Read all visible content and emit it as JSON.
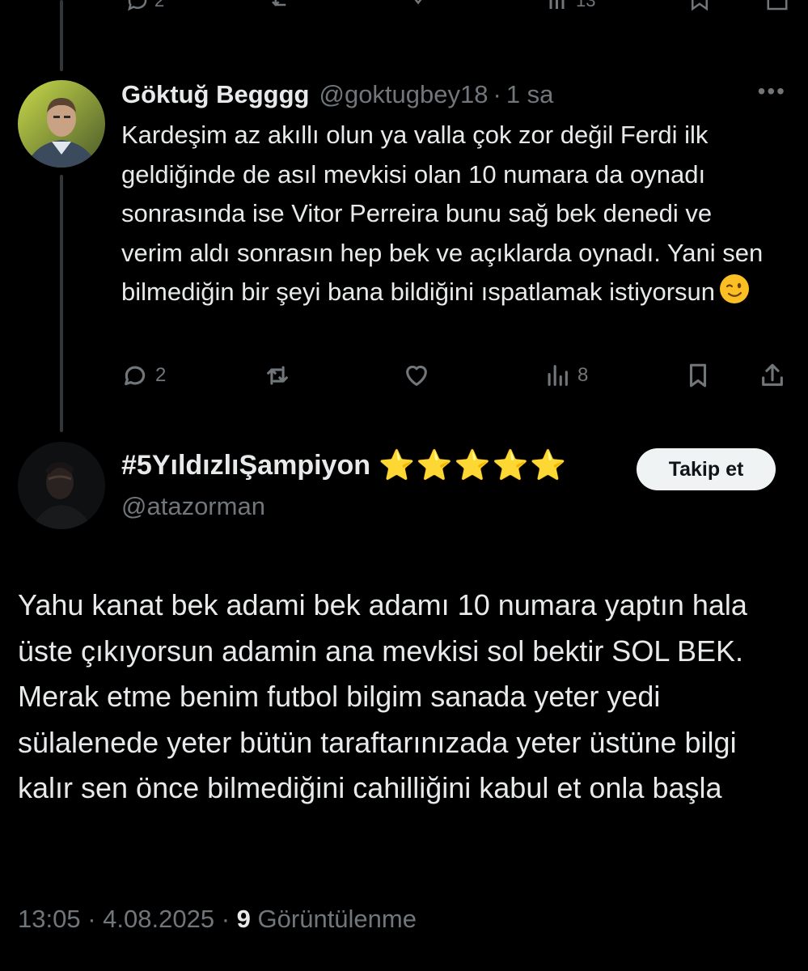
{
  "top_actions": {
    "replies": "2",
    "views": "13"
  },
  "reply": {
    "name": "Göktuğ Begggg",
    "handle": "@goktugbey18",
    "separator": "·",
    "time": "1 sa",
    "more_icon": "more-horizontal-icon",
    "text": "Kardeşim az akıllı olun ya valla çok zor değil Ferdi ilk geldiğinde de asıl mevkisi olan 10 numara da oynadı sonrasında ise Vitor Perreira bunu sağ bek denedi ve verim aldı sonrasın hep bek ve açıklarda oynadı. Yani sen bilmediğin bir şeyi bana bildiğini ıspatlamak istiyorsun",
    "emoji": "winking-face-emoji",
    "actions": {
      "reply_count": "2",
      "view_count": "8"
    }
  },
  "main_tweet": {
    "name": "#5YıldızlıŞampiyon",
    "stars": "⭐⭐⭐⭐⭐",
    "handle": "@atazorman",
    "follow_label": "Takip et",
    "text": "Yahu kanat bek adami bek adamı 10 numara yaptın hala üste çıkıyorsun adamin ana mevkisi sol bektir SOL BEK. Merak etme benim futbol bilgim sanada yeter yedi sülalenede yeter bütün taraftarınızada yeter üstüne bilgi kalır sen önce bilmediğini cahilliğini kabul et onla başla",
    "time": "13:05",
    "date": "4.08.2025",
    "separator": "·",
    "views": "9",
    "views_label": "Görüntülenme"
  },
  "colors": {
    "background": "#000000",
    "text": "#e7e9ea",
    "secondary": "#71767b",
    "thread_line": "#333639",
    "follow_bg": "#eff3f4"
  }
}
